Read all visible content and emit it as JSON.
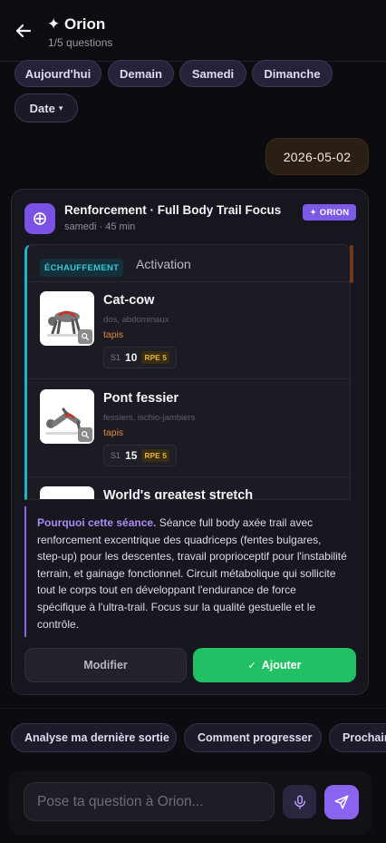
{
  "header": {
    "title": "✦ Orion",
    "subtitle": "1/5 questions"
  },
  "chips": {
    "day_options": [
      "Aujourd'hui",
      "Demain",
      "Samedi",
      "Dimanche"
    ],
    "date_label": "Date",
    "date_arrow": "▾"
  },
  "user_message": "2026-05-02",
  "workout": {
    "title": "Renforcement · Full Body Trail Focus",
    "meta": "samedi · 45 min",
    "badge": "✦ ORION",
    "section_tag": "ÉCHAUFFEMENT",
    "section_name": "Activation",
    "exercises": [
      {
        "name": "Cat-cow",
        "muscles": "dos, abdominaux",
        "equipment": "tapis",
        "set_label": "S1",
        "reps": "10",
        "rpe": "RPE 5"
      },
      {
        "name": "Pont fessier",
        "muscles": "fessiers, ischio-jambiers",
        "equipment": "tapis",
        "set_label": "S1",
        "reps": "15",
        "rpe": "RPE 5"
      },
      {
        "name": "World's greatest stretch"
      }
    ],
    "why_label": "Pourquoi cette séance.",
    "why_text": " Séance full body axée trail avec renforcement excentrique des quadriceps (fentes bulgares, step-up) pour les descentes, travail proprioceptif pour l'instabilité terrain, et gainage fonctionnel. Circuit métabolique qui sollicite tout le corps tout en développant l'endurance de force spécifique à l'ultra-trail. Focus sur la qualité gestuelle et le contrôle.",
    "modify_label": "Modifier",
    "add_label": "Ajouter",
    "add_icon": "✓"
  },
  "suggestions": [
    "Analyse ma dernière sortie",
    "Comment progresser",
    "Prochaine"
  ],
  "composer": {
    "placeholder": "Pose ta question à Orion..."
  },
  "colors": {
    "accent": "#8a63f0",
    "success": "#22c065",
    "section": "#1fb4c7",
    "equipment": "#e08a3a"
  }
}
